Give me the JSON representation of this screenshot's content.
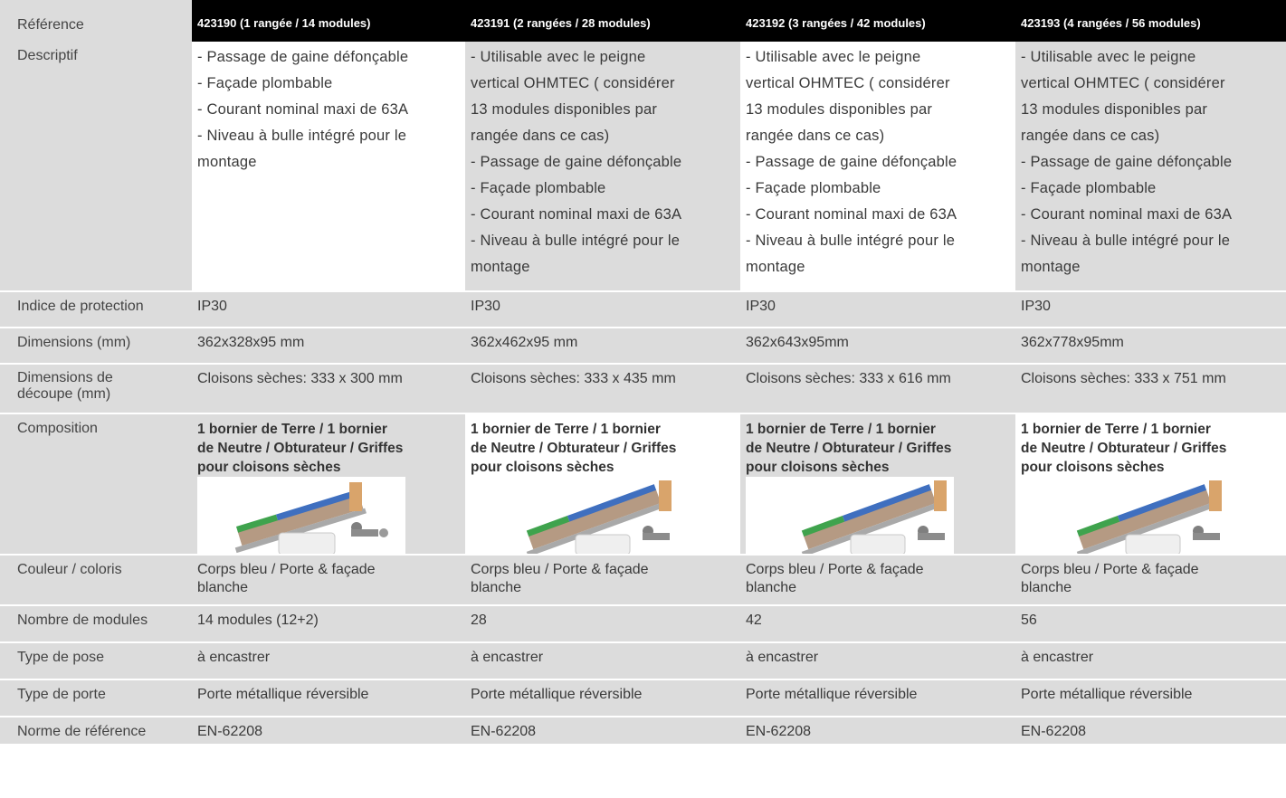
{
  "columns": [
    {
      "header": "423190 (1 rangée / 14 modules)"
    },
    {
      "header": "423191 (2 rangées / 28 modules)"
    },
    {
      "header": "423192 (3 rangées / 42 modules)"
    },
    {
      "header": "423193 (4 rangées / 56 modules)"
    }
  ],
  "labels": {
    "reference": "Référence",
    "descriptif": "Descriptif",
    "protection": "Indice de protection",
    "dimensions": "Dimensions (mm)",
    "decoupe": "Dimensions de\ndécoupe (mm)",
    "composition": "Composition",
    "couleur": "Couleur / coloris",
    "modules": "Nombre de modules",
    "pose": "Type de pose",
    "porte": "Type de porte",
    "norme": "Norme de référence"
  },
  "descriptif": {
    "c1": [
      "- Passage de gaine défonçable",
      "- Façade plombable",
      "- Courant nominal maxi de 63A",
      "- Niveau à bulle intégré pour le",
      "montage"
    ],
    "c2": [
      "- Utilisable avec le peigne",
      "vertical OHMTEC ( considérer",
      "13 modules disponibles par",
      "rangée dans ce cas)",
      "- Passage de gaine défonçable",
      "- Façade plombable",
      "- Courant nominal maxi de 63A",
      "- Niveau à bulle intégré pour le",
      "montage"
    ],
    "c3": [
      "- Utilisable avec le peigne",
      "vertical OHMTEC ( considérer",
      "13 modules disponibles par",
      "rangée dans ce cas)",
      "- Passage de gaine défonçable",
      "- Façade plombable",
      "- Courant nominal maxi de 63A",
      "- Niveau à bulle intégré pour le",
      "montage"
    ],
    "c4": [
      "- Utilisable avec le peigne",
      "vertical OHMTEC ( considérer",
      "13 modules disponibles par",
      "rangée dans ce cas)",
      "- Passage de gaine défonçable",
      "- Façade plombable",
      "- Courant nominal maxi de 63A",
      "- Niveau à bulle intégré pour le",
      "montage"
    ]
  },
  "protection": [
    "IP30",
    "IP30",
    "IP30",
    "IP30"
  ],
  "dimensions": [
    "362x328x95 mm",
    "362x462x95 mm",
    "362x643x95mm",
    "362x778x95mm"
  ],
  "decoupe": [
    "Cloisons sèches: 333 x 300 mm",
    "Cloisons sèches: 333 x 435 mm",
    "Cloisons sèches: 333 x 616 mm",
    "Cloisons sèches: 333 x 751 mm"
  ],
  "composition": "1 bornier de Terre / 1 bornier\nde Neutre / Obturateur / Griffes\npour cloisons sèches",
  "couleur": "Corps bleu / Porte & façade\nblanche",
  "modules": [
    "14 modules (12+2)",
    "28",
    "42",
    "56"
  ],
  "pose": "à encastrer",
  "porte": "Porte métallique réversible",
  "norme": "EN-62208",
  "colors": {
    "header_bg": "#000000",
    "label_bg": "#dcdcdc",
    "cell_grey": "#dcdcdc",
    "cell_white": "#ffffff",
    "bornier_blue": "#3f6fbf",
    "bornier_green": "#3fa34d"
  }
}
